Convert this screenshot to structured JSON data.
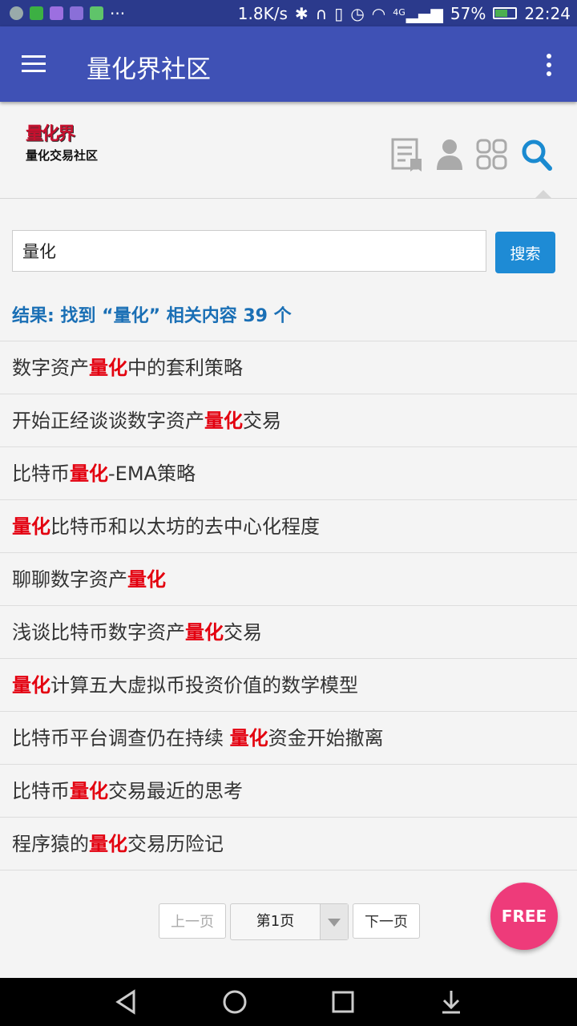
{
  "status_bar": {
    "net_speed": "1.8K/s",
    "network": "4G",
    "battery": "57%",
    "time": "22:24",
    "more": "···"
  },
  "app_bar": {
    "title": "量化界社区"
  },
  "logo": {
    "top_text": "量化界",
    "bottom_text": "量化交易社区"
  },
  "header_icons": [
    "article-icon",
    "user-icon",
    "apps-grid-icon",
    "search-icon"
  ],
  "search": {
    "value": "量化",
    "button_label": "搜索"
  },
  "summary": "结果: 找到 “量化” 相关内容 39 个",
  "results": [
    [
      {
        "t": "数字资产"
      },
      {
        "t": "量化",
        "hl": true
      },
      {
        "t": "中的套利策略"
      }
    ],
    [
      {
        "t": "开始正经谈谈数字资产"
      },
      {
        "t": "量化",
        "hl": true
      },
      {
        "t": "交易"
      }
    ],
    [
      {
        "t": "比特币"
      },
      {
        "t": "量化",
        "hl": true
      },
      {
        "t": "-EMA策略"
      }
    ],
    [
      {
        "t": "量化",
        "hl": true
      },
      {
        "t": "比特币和以太坊的去中心化程度"
      }
    ],
    [
      {
        "t": "聊聊数字资产"
      },
      {
        "t": "量化",
        "hl": true
      }
    ],
    [
      {
        "t": "浅谈比特币数字资产"
      },
      {
        "t": "量化",
        "hl": true
      },
      {
        "t": "交易"
      }
    ],
    [
      {
        "t": "量化",
        "hl": true
      },
      {
        "t": "计算五大虚拟币投资价值的数学模型"
      }
    ],
    [
      {
        "t": "比特币平台调查仍在持续 "
      },
      {
        "t": "量化",
        "hl": true
      },
      {
        "t": "资金开始撤离"
      }
    ],
    [
      {
        "t": "比特币"
      },
      {
        "t": "量化",
        "hl": true
      },
      {
        "t": "交易最近的思考"
      }
    ],
    [
      {
        "t": "程序猿的"
      },
      {
        "t": "量化",
        "hl": true
      },
      {
        "t": "交易历险记"
      }
    ]
  ],
  "pagination": {
    "prev": "上一页",
    "current": "第1页",
    "next": "下一页"
  },
  "fab": {
    "label": "FREE"
  },
  "colors": {
    "app_bar": "#3f51b5",
    "status_bar": "#2b3a8c",
    "highlight": "#e3000f",
    "link": "#1a6fb5",
    "button": "#1e8bd5",
    "fab": "#ee3b7a"
  }
}
